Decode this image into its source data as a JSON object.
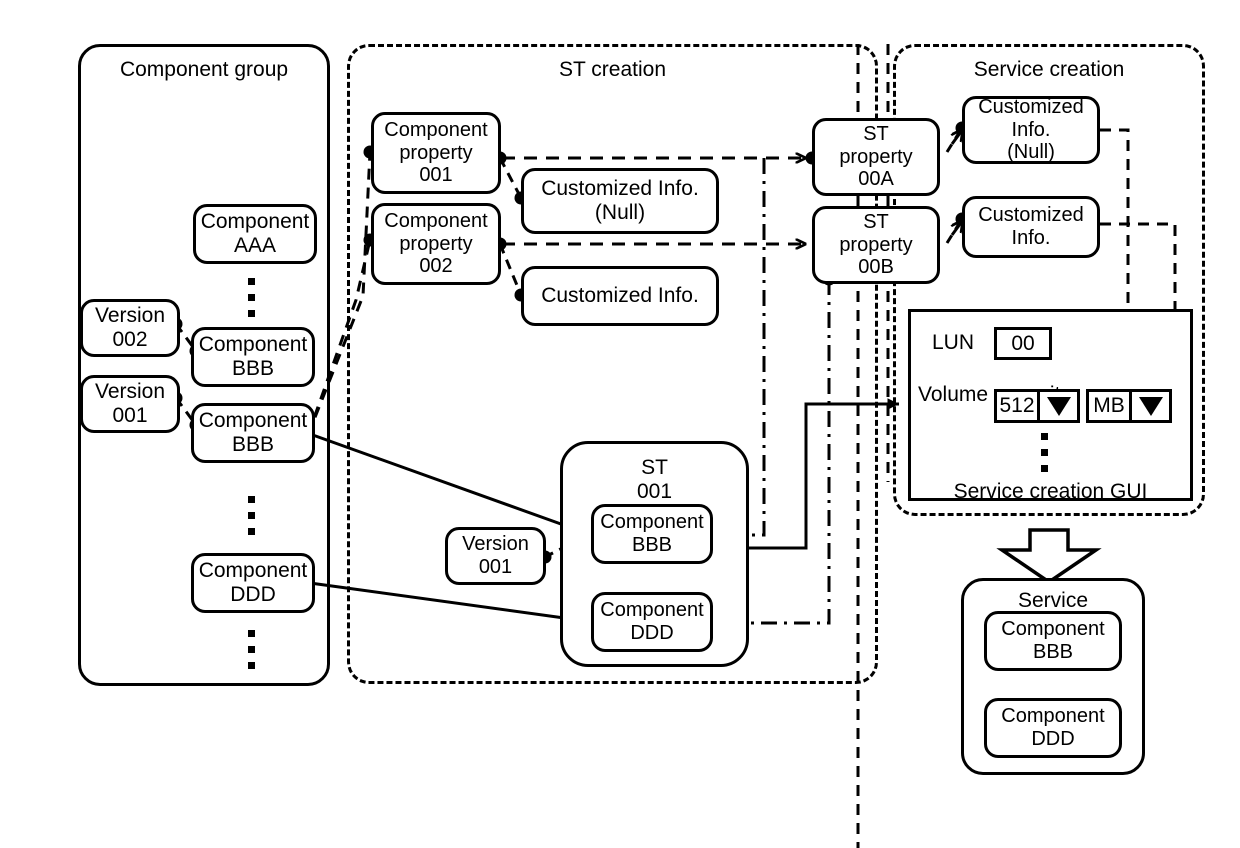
{
  "groups": {
    "component_group": "Component group",
    "st_creation": "ST creation",
    "service_creation": "Service creation",
    "service_creation_gui": "Service creation GUI",
    "service": "Service"
  },
  "component_group": {
    "component_aaa": [
      "Component",
      "AAA"
    ],
    "version_002": [
      "Version",
      "002"
    ],
    "component_bbb_v2": [
      "Component",
      "BBB"
    ],
    "version_001": [
      "Version",
      "001"
    ],
    "component_bbb_v1": [
      "Component",
      "BBB"
    ],
    "component_ddd": [
      "Component",
      "DDD"
    ]
  },
  "st_creation": {
    "component_property_001": [
      "Component",
      "property",
      "001"
    ],
    "component_property_002": [
      "Component",
      "property",
      "002"
    ],
    "customized_info_null": [
      "Customized Info.",
      "(Null)"
    ],
    "customized_info": [
      "Customized Info."
    ],
    "st_property_00a": [
      "ST",
      "property",
      "00A"
    ],
    "st_property_00b": [
      "ST",
      "property",
      "00B"
    ],
    "st_001": [
      "ST",
      "001"
    ],
    "st_version_001": [
      "Version",
      "001"
    ],
    "st_component_bbb": [
      "Component",
      "BBB"
    ],
    "st_component_ddd": [
      "Component",
      "DDD"
    ]
  },
  "service_creation": {
    "customized_info_null": [
      "Customized",
      "Info.",
      "(Null)"
    ],
    "customized_info": [
      "Customized",
      "Info."
    ],
    "gui": {
      "lun_label": "LUN",
      "lun_value": "00",
      "volume_capacity_label": [
        "Volume",
        "capacity"
      ],
      "volume_value": "512",
      "volume_unit": "MB"
    }
  },
  "service": {
    "component_bbb": [
      "Component",
      "BBB"
    ],
    "component_ddd": [
      "Component",
      "DDD"
    ]
  },
  "colors": {
    "stroke": "#000000",
    "background": "#ffffff"
  }
}
